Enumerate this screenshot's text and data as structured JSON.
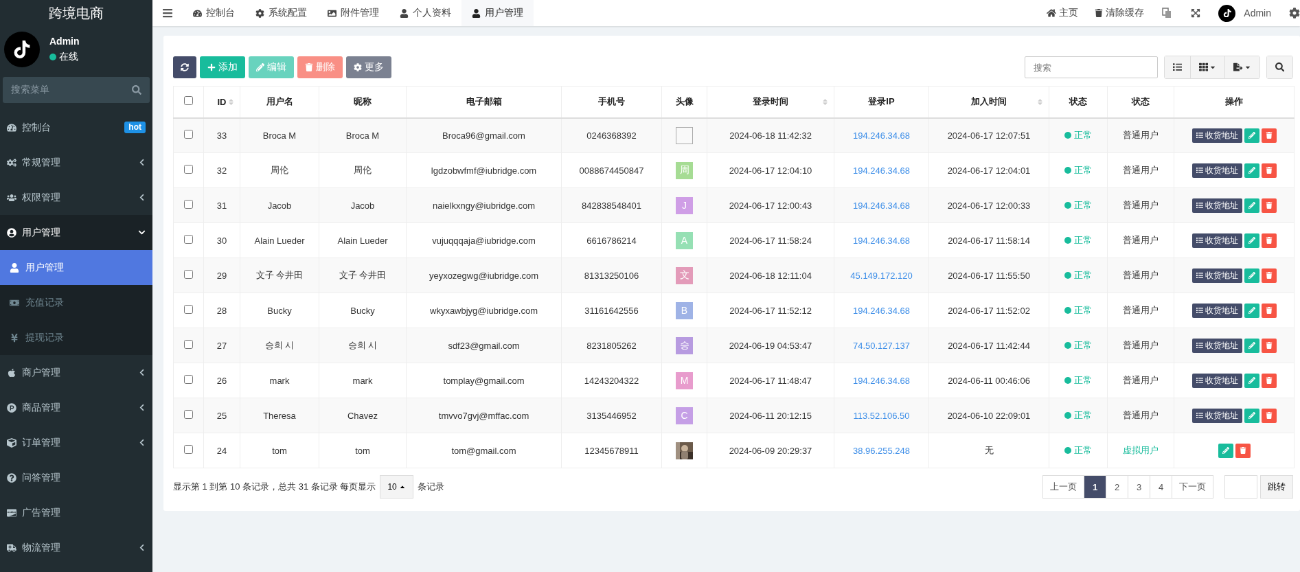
{
  "sidebar": {
    "brand": "跨境电商",
    "user": {
      "name": "Admin",
      "status": "在线"
    },
    "search": {
      "placeholder": "搜索菜单"
    },
    "items": [
      {
        "label": "控制台",
        "badge": "hot"
      },
      {
        "label": "常规管理",
        "expanded": false
      },
      {
        "label": "权限管理",
        "expanded": false
      },
      {
        "label": "用户管理",
        "expanded": true,
        "children": [
          {
            "label": "用户管理",
            "selected": true
          },
          {
            "label": "充值记录",
            "selected": false
          },
          {
            "label": "提现记录",
            "selected": false
          }
        ]
      },
      {
        "label": "商户管理",
        "expanded": false
      },
      {
        "label": "商品管理",
        "expanded": false
      },
      {
        "label": "订单管理",
        "expanded": false
      },
      {
        "label": "问答管理"
      },
      {
        "label": "广告管理"
      },
      {
        "label": "物流管理",
        "expanded": false
      }
    ]
  },
  "tabs": [
    {
      "label": "控制台",
      "selected": false
    },
    {
      "label": "系统配置",
      "selected": false
    },
    {
      "label": "附件管理",
      "selected": false
    },
    {
      "label": "个人资料",
      "selected": false
    },
    {
      "label": "用户管理",
      "selected": true
    }
  ],
  "topbar": {
    "home": "主页",
    "clear_cache": "清除缓存",
    "user": "Admin"
  },
  "toolbar": {
    "buttons": [
      {
        "label": "添加",
        "kind": "add",
        "disabled": false
      },
      {
        "label": "编辑",
        "kind": "edit",
        "disabled": true
      },
      {
        "label": "删除",
        "kind": "delete",
        "disabled": true
      },
      {
        "label": "更多",
        "kind": "more",
        "disabled": false
      }
    ],
    "search": {
      "placeholder": "搜索"
    }
  },
  "table": {
    "header_checked": false,
    "columns": [
      {
        "label": "ID",
        "sortable": true
      },
      {
        "label": "用户名",
        "sortable": false
      },
      {
        "label": "昵称",
        "sortable": false
      },
      {
        "label": "电子邮箱",
        "sortable": false
      },
      {
        "label": "手机号",
        "sortable": false
      },
      {
        "label": "头像",
        "sortable": false
      },
      {
        "label": "登录时间",
        "sortable": true
      },
      {
        "label": "登录IP",
        "sortable": false
      },
      {
        "label": "加入时间",
        "sortable": true
      },
      {
        "label": "状态",
        "sortable": false
      },
      {
        "label": "状态",
        "sortable": false
      },
      {
        "label": "操作",
        "sortable": false
      }
    ],
    "rows": [
      {
        "checked": false,
        "id": "33",
        "username": "Broca M",
        "nickname": "Broca M",
        "email": "Broca96@gmail.com",
        "phone": "0246368392",
        "avatar": {
          "kind": "broken"
        },
        "login_time": "2024-06-18 11:42:32",
        "ip": "194.246.34.68",
        "join_time": "2024-06-17 12:07:51",
        "status": "正常",
        "user_type": {
          "label": "普通用户",
          "kind": "normal"
        },
        "address": "收货地址"
      },
      {
        "checked": false,
        "id": "32",
        "username": "周伦",
        "nickname": "周伦",
        "email": "lgdzobwfmf@iubridge.com",
        "phone": "0088674450847",
        "avatar": {
          "kind": "letter",
          "text": "周",
          "color": "#a6dc94"
        },
        "login_time": "2024-06-17 12:04:10",
        "ip": "194.246.34.68",
        "join_time": "2024-06-17 12:04:01",
        "status": "正常",
        "user_type": {
          "label": "普通用户",
          "kind": "normal"
        },
        "address": "收货地址"
      },
      {
        "checked": false,
        "id": "31",
        "username": "Jacob",
        "nickname": "Jacob",
        "email": "naielkxngy@iubridge.com",
        "phone": "842838548401",
        "avatar": {
          "kind": "letter",
          "text": "J",
          "color": "#cf9ee6"
        },
        "login_time": "2024-06-17 12:00:43",
        "ip": "194.246.34.68",
        "join_time": "2024-06-17 12:00:33",
        "status": "正常",
        "user_type": {
          "label": "普通用户",
          "kind": "normal"
        },
        "address": "收货地址"
      },
      {
        "checked": false,
        "id": "30",
        "username": "Alain Lueder",
        "nickname": "Alain Lueder",
        "email": "vujuqqqaja@iubridge.com",
        "phone": "6616786214",
        "avatar": {
          "kind": "letter",
          "text": "A",
          "color": "#96e0b4"
        },
        "login_time": "2024-06-17 11:58:24",
        "ip": "194.246.34.68",
        "join_time": "2024-06-17 11:58:14",
        "status": "正常",
        "user_type": {
          "label": "普通用户",
          "kind": "normal"
        },
        "address": "收货地址"
      },
      {
        "checked": false,
        "id": "29",
        "username": "文子 今井田",
        "nickname": "文子 今井田",
        "email": "yeyxozegwg@iubridge.com",
        "phone": "81313250106",
        "avatar": {
          "kind": "letter",
          "text": "文",
          "color": "#e39bb9"
        },
        "login_time": "2024-06-18 12:11:04",
        "ip": "45.149.172.120",
        "join_time": "2024-06-17 11:55:50",
        "status": "正常",
        "user_type": {
          "label": "普通用户",
          "kind": "normal"
        },
        "address": "收货地址"
      },
      {
        "checked": false,
        "id": "28",
        "username": "Bucky",
        "nickname": "Bucky",
        "email": "wkyxawbjyg@iubridge.com",
        "phone": "31161642556",
        "avatar": {
          "kind": "letter",
          "text": "B",
          "color": "#9fb3e6"
        },
        "login_time": "2024-06-17 11:52:12",
        "ip": "194.246.34.68",
        "join_time": "2024-06-17 11:52:02",
        "status": "正常",
        "user_type": {
          "label": "普通用户",
          "kind": "normal"
        },
        "address": "收货地址"
      },
      {
        "checked": false,
        "id": "27",
        "username": "승희 시",
        "nickname": "승희 시",
        "email": "sdf23@gmail.com",
        "phone": "8231805262",
        "avatar": {
          "kind": "letter",
          "text": "승",
          "color": "#b79be0"
        },
        "login_time": "2024-06-19 04:53:47",
        "ip": "74.50.127.137",
        "join_time": "2024-06-17 11:42:44",
        "status": "正常",
        "user_type": {
          "label": "普通用户",
          "kind": "normal"
        },
        "address": "收货地址"
      },
      {
        "checked": false,
        "id": "26",
        "username": "mark",
        "nickname": "mark",
        "email": "tomplay@gmail.com",
        "phone": "14243204322",
        "avatar": {
          "kind": "letter",
          "text": "M",
          "color": "#e89ccd"
        },
        "login_time": "2024-06-17 11:48:47",
        "ip": "194.246.34.68",
        "join_time": "2024-06-11 00:46:06",
        "status": "正常",
        "user_type": {
          "label": "普通用户",
          "kind": "normal"
        },
        "address": "收货地址"
      },
      {
        "checked": false,
        "id": "25",
        "username": "Theresa",
        "nickname": "Chavez",
        "email": "tmvvo7gvj@mffac.com",
        "phone": "3135446952",
        "avatar": {
          "kind": "letter",
          "text": "C",
          "color": "#c59fe6"
        },
        "login_time": "2024-06-11 20:12:15",
        "ip": "113.52.106.50",
        "join_time": "2024-06-10 22:09:01",
        "status": "正常",
        "user_type": {
          "label": "普通用户",
          "kind": "normal"
        },
        "address": "收货地址"
      },
      {
        "checked": false,
        "id": "24",
        "username": "tom",
        "nickname": "tom",
        "email": "tom@gmail.com",
        "phone": "12345678911",
        "login_time": "2024-06-09 20:29:37",
        "ip": "38.96.255.248",
        "join_time": "无",
        "status": "正常",
        "user_type": {
          "label": "虚拟用户",
          "kind": "virtual"
        }
      }
    ]
  },
  "footer": {
    "summary": "显示第 1 到第 10 条记录，总共 31 条记录 每页显示",
    "page_size": "10",
    "suffix": "条记录"
  },
  "pagination": {
    "prev": "上一页",
    "pages": [
      {
        "label": "1",
        "selected": true
      },
      {
        "label": "2",
        "selected": false
      },
      {
        "label": "3",
        "selected": false
      },
      {
        "label": "4",
        "selected": false
      }
    ],
    "next": "下一页",
    "jump": "跳转"
  }
}
